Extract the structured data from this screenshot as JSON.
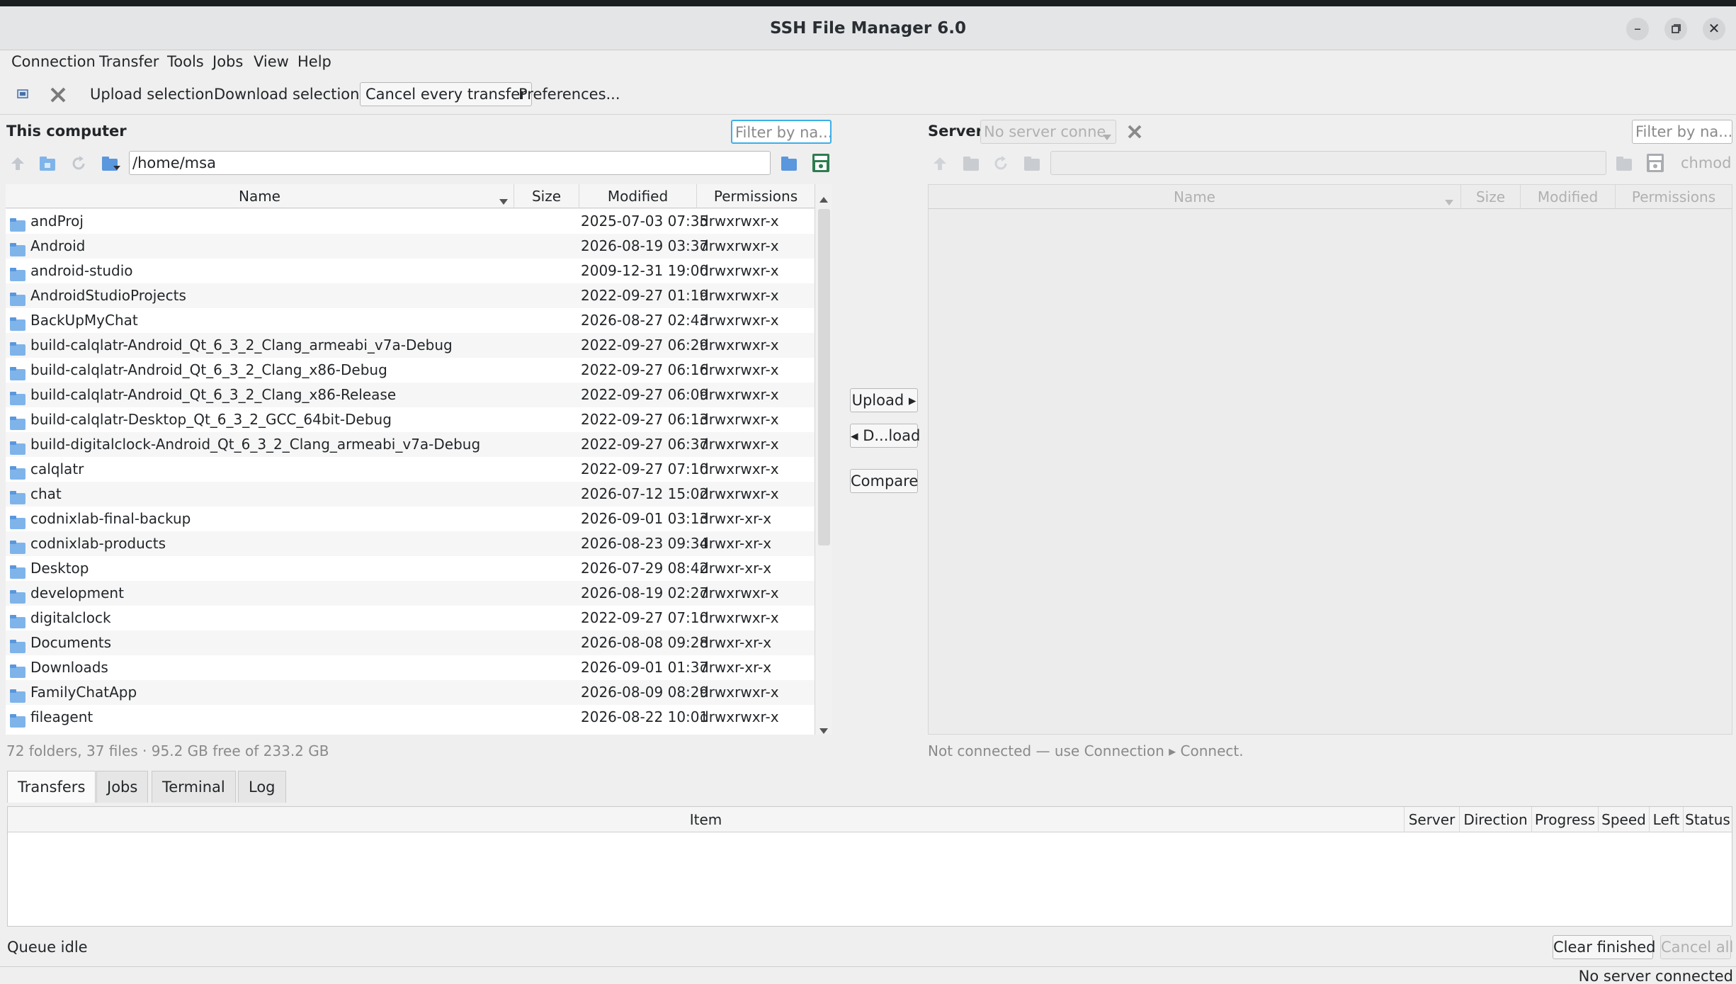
{
  "window": {
    "title": "SSH File Manager 6.0"
  },
  "menus": [
    "Connection",
    "Transfer",
    "Tools",
    "Jobs",
    "View",
    "Help"
  ],
  "toolbar": {
    "upload_label": "Upload selection",
    "download_label": "Download selection",
    "cancel_label": "Cancel every transfer",
    "prefs_label": "Preferences..."
  },
  "local": {
    "title": "This computer",
    "filter_placeholder": "Filter by na...",
    "path": "/home/msa",
    "columns": {
      "name": "Name",
      "size": "Size",
      "modified": "Modified",
      "permissions": "Permissions"
    },
    "rows": [
      {
        "name": "andProj",
        "modified": "2025-07-03 07:35",
        "permissions": "drwxrwxr-x"
      },
      {
        "name": "Android",
        "modified": "2026-08-19 03:37",
        "permissions": "drwxrwxr-x"
      },
      {
        "name": "android-studio",
        "modified": "2009-12-31 19:00",
        "permissions": "drwxrwxr-x"
      },
      {
        "name": "AndroidStudioProjects",
        "modified": "2022-09-27 01:19",
        "permissions": "drwxrwxr-x"
      },
      {
        "name": "BackUpMyChat",
        "modified": "2026-08-27 02:43",
        "permissions": "drwxrwxr-x"
      },
      {
        "name": "build-calqlatr-Android_Qt_6_3_2_Clang_armeabi_v7a-Debug",
        "modified": "2022-09-27 06:29",
        "permissions": "drwxrwxr-x"
      },
      {
        "name": "build-calqlatr-Android_Qt_6_3_2_Clang_x86-Debug",
        "modified": "2022-09-27 06:16",
        "permissions": "drwxrwxr-x"
      },
      {
        "name": "build-calqlatr-Android_Qt_6_3_2_Clang_x86-Release",
        "modified": "2022-09-27 06:09",
        "permissions": "drwxrwxr-x"
      },
      {
        "name": "build-calqlatr-Desktop_Qt_6_3_2_GCC_64bit-Debug",
        "modified": "2022-09-27 06:13",
        "permissions": "drwxrwxr-x"
      },
      {
        "name": "build-digitalclock-Android_Qt_6_3_2_Clang_armeabi_v7a-Debug",
        "modified": "2022-09-27 06:37",
        "permissions": "drwxrwxr-x"
      },
      {
        "name": "calqlatr",
        "modified": "2022-09-27 07:10",
        "permissions": "drwxrwxr-x"
      },
      {
        "name": "chat",
        "modified": "2026-07-12 15:02",
        "permissions": "drwxrwxr-x"
      },
      {
        "name": "codnixlab-final-backup",
        "modified": "2026-09-01 03:13",
        "permissions": "drwxr-xr-x"
      },
      {
        "name": "codnixlab-products",
        "modified": "2026-08-23 09:34",
        "permissions": "drwxr-xr-x"
      },
      {
        "name": "Desktop",
        "modified": "2026-07-29 08:42",
        "permissions": "drwxr-xr-x"
      },
      {
        "name": "development",
        "modified": "2026-08-19 02:27",
        "permissions": "drwxrwxr-x"
      },
      {
        "name": "digitalclock",
        "modified": "2022-09-27 07:10",
        "permissions": "drwxrwxr-x"
      },
      {
        "name": "Documents",
        "modified": "2026-08-08 09:28",
        "permissions": "drwxr-xr-x"
      },
      {
        "name": "Downloads",
        "modified": "2026-09-01 01:37",
        "permissions": "drwxr-xr-x"
      },
      {
        "name": "FamilyChatApp",
        "modified": "2026-08-09 08:29",
        "permissions": "drwxrwxr-x"
      },
      {
        "name": "fileagent",
        "modified": "2026-08-22 10:01",
        "permissions": "drwxrwxr-x"
      }
    ],
    "status": "72 folders, 37 files · 95.2 GB free of 233.2 GB"
  },
  "middle": {
    "upload": "Upload ▸",
    "download": "◂ D...load",
    "compare": "Compare"
  },
  "remote": {
    "title": "Server",
    "server_select": "No server conne",
    "filter_placeholder": "Filter by na...",
    "chmod_label": "chmod",
    "columns": {
      "name": "Name",
      "size": "Size",
      "modified": "Modified",
      "permissions": "Permissions"
    },
    "status": "Not connected — use Connection ▸ Connect."
  },
  "bottom": {
    "tabs": [
      "Transfers",
      "Jobs",
      "Terminal",
      "Log"
    ],
    "columns": [
      "Item",
      "Server",
      "Direction",
      "Progress",
      "Speed",
      "Left",
      "Status"
    ],
    "queue_status": "Queue idle",
    "clear_finished": "Clear finished",
    "cancel_all": "Cancel all"
  },
  "statusbar": {
    "text": "No server connected"
  }
}
